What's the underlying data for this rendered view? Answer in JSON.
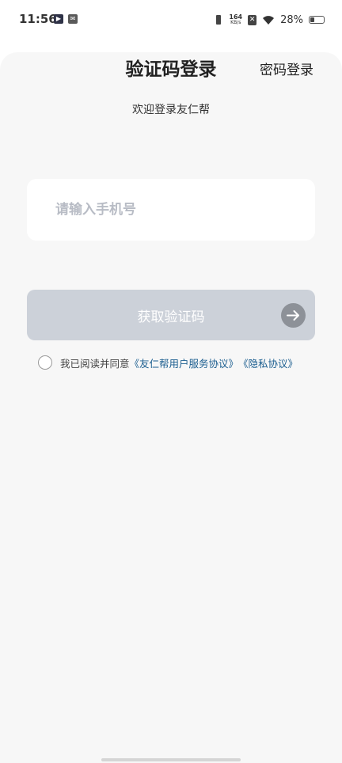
{
  "status_bar": {
    "time": "11:56",
    "net_speed_value": "164",
    "net_speed_unit": "KB/s",
    "battery_percent": "28%",
    "battery_level": 0.28,
    "icons": [
      "play-app-icon",
      "mail-app-icon",
      "vibrate-icon",
      "x-icon",
      "wifi-icon",
      "battery-icon"
    ]
  },
  "header": {
    "title": "验证码登录",
    "password_login": "密码登录"
  },
  "subtitle": "欢迎登录友仁帮",
  "phone": {
    "value": "",
    "placeholder": "请输入手机号"
  },
  "get_code": {
    "label": "获取验证码",
    "icon": "arrow-right-icon"
  },
  "agreement": {
    "checked": false,
    "prefix": "我已阅读并同意",
    "service_link": "《友仁帮用户服务协议》",
    "privacy_link": "《隐私协议》"
  },
  "colors": {
    "sheet_background": "#f7f7f7",
    "button_disabled": "#ccd1d9",
    "link": "#1a5d8f"
  }
}
